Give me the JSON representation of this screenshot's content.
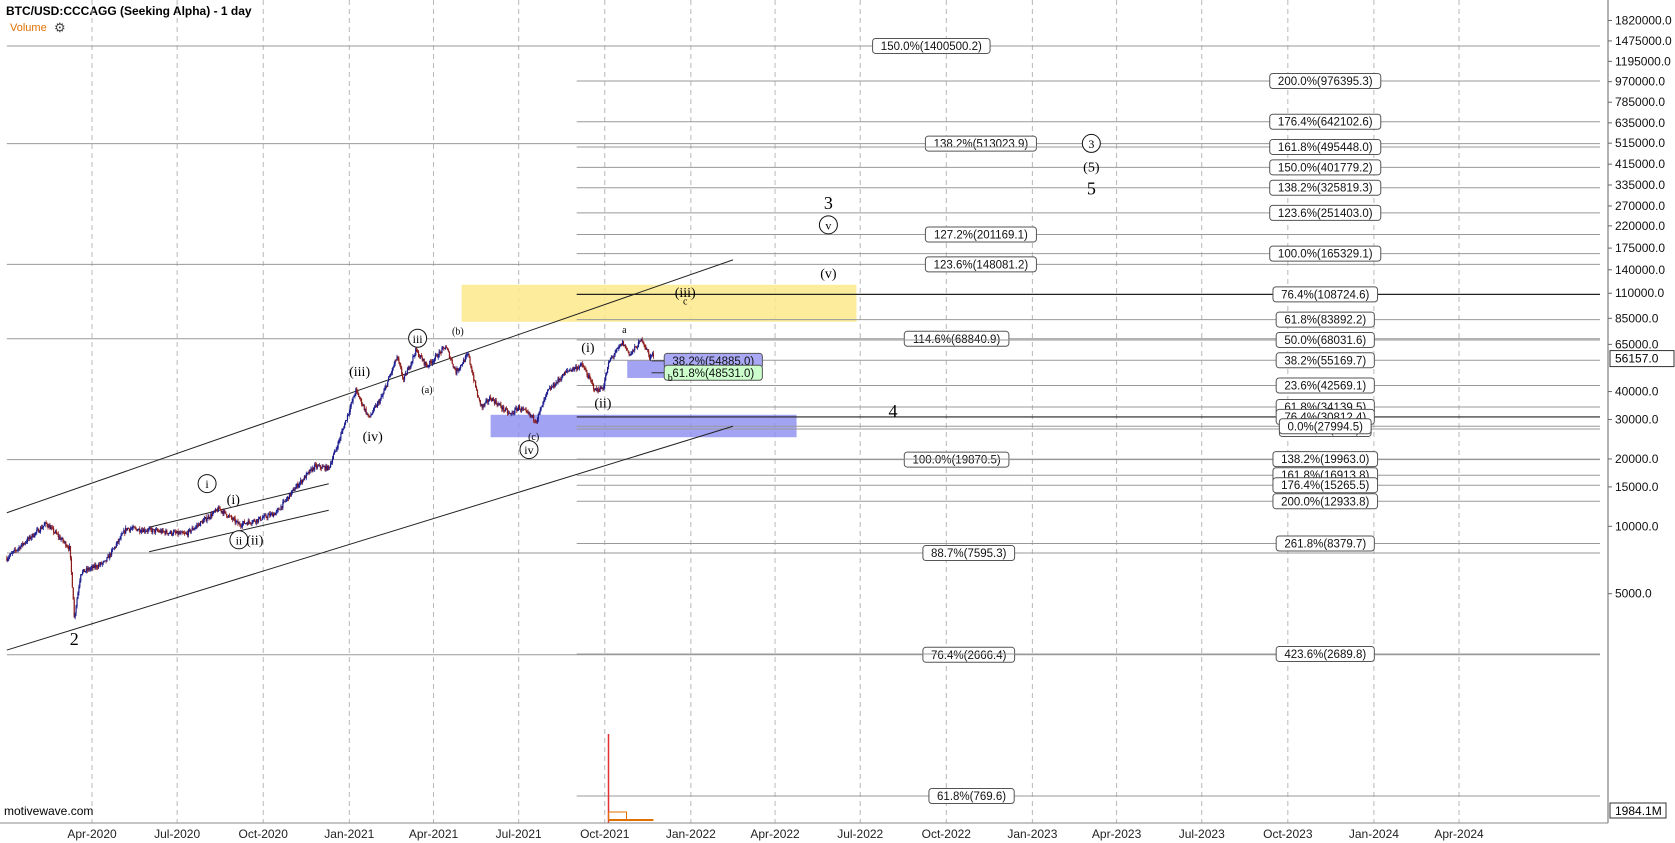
{
  "header": {
    "title": "BTC/USD:CCCAGG (Seeking Alpha) - 1 day",
    "volume_label": "Volume",
    "settings_icon": "gear-icon"
  },
  "watermark": "motivewave.com",
  "colors": {
    "candle_up": "#1a1a8c",
    "candle_down": "#8b1a1a",
    "yellow_zone": "#fbe98a",
    "blue_zone": "#8c8cf0",
    "price_label_bg": "#ffffff",
    "green_label": "#ccffcc",
    "volume": "#e03030"
  },
  "chart_data": {
    "type": "candlestick",
    "title": "BTC/USD:CCCAGG (Seeking Alpha) - 1 day",
    "y_scale": "log",
    "ylim": [
      2000,
      2300000
    ],
    "x_range": [
      "2020-01-01",
      "2024-05-31"
    ],
    "x_tick_labels": [
      "Apr-2020",
      "Jul-2020",
      "Oct-2020",
      "Jan-2021",
      "Apr-2021",
      "Jul-2021",
      "Oct-2021",
      "Jan-2022",
      "Apr-2022",
      "Jul-2022",
      "Oct-2022",
      "Jan-2023",
      "Apr-2023",
      "Jul-2023",
      "Oct-2023",
      "Jan-2024",
      "Apr-2024"
    ],
    "x_ticks": [
      "2020-04-01",
      "2020-07-01",
      "2020-10-01",
      "2021-01-01",
      "2021-04-01",
      "2021-07-01",
      "2021-10-01",
      "2022-01-01",
      "2022-04-01",
      "2022-07-01",
      "2022-10-01",
      "2023-01-01",
      "2023-04-01",
      "2023-07-01",
      "2023-10-01",
      "2024-01-01",
      "2024-04-01"
    ],
    "y_tick_labels": [
      "1820000.0",
      "1475000.0",
      "1195000.0",
      "970000.0",
      "785000.0",
      "635000.0",
      "515000.0",
      "415000.0",
      "335000.0",
      "270000.0",
      "220000.0",
      "175000.0",
      "140000.0",
      "110000.0",
      "85000.0",
      "65000.0",
      "40000.0",
      "30000.0",
      "20000.0",
      "15000.0",
      "10000.0",
      "5000.0"
    ],
    "y_ticks": [
      1820000,
      1475000,
      1195000,
      970000,
      785000,
      635000,
      515000,
      415000,
      335000,
      270000,
      220000,
      175000,
      140000,
      110000,
      85000,
      65000,
      40000,
      30000,
      20000,
      15000,
      10000,
      5000
    ],
    "current_price_label": "56157.0",
    "volume_label": "1984.1M",
    "price_path": [
      [
        "2020-01-01",
        7200
      ],
      [
        "2020-02-12",
        10300
      ],
      [
        "2020-03-08",
        8000
      ],
      [
        "2020-03-12",
        4800
      ],
      [
        "2020-03-13",
        3900
      ],
      [
        "2020-03-20",
        6200
      ],
      [
        "2020-04-15",
        6900
      ],
      [
        "2020-05-08",
        9800
      ],
      [
        "2020-06-01",
        9600
      ],
      [
        "2020-07-10",
        9200
      ],
      [
        "2020-08-15",
        12000
      ],
      [
        "2020-09-05",
        10200
      ],
      [
        "2020-09-25",
        10700
      ],
      [
        "2020-10-15",
        11500
      ],
      [
        "2020-11-05",
        15000
      ],
      [
        "2020-11-25",
        18500
      ],
      [
        "2020-12-10",
        18200
      ],
      [
        "2020-12-20",
        23500
      ],
      [
        "2021-01-08",
        40500
      ],
      [
        "2021-01-22",
        30500
      ],
      [
        "2021-02-05",
        38000
      ],
      [
        "2021-02-21",
        57000
      ],
      [
        "2021-02-28",
        45000
      ],
      [
        "2021-03-13",
        61000
      ],
      [
        "2021-03-25",
        52000
      ],
      [
        "2021-04-14",
        63500
      ],
      [
        "2021-04-25",
        49000
      ],
      [
        "2021-05-08",
        58500
      ],
      [
        "2021-05-19",
        37000
      ],
      [
        "2021-05-23",
        34000
      ],
      [
        "2021-06-01",
        37500
      ],
      [
        "2021-06-22",
        31500
      ],
      [
        "2021-07-01",
        34000
      ],
      [
        "2021-07-20",
        29800
      ],
      [
        "2021-08-01",
        40000
      ],
      [
        "2021-08-22",
        49500
      ],
      [
        "2021-09-07",
        52500
      ],
      [
        "2021-09-21",
        40500
      ],
      [
        "2021-09-29",
        41500
      ],
      [
        "2021-10-06",
        55000
      ],
      [
        "2021-10-20",
        66000
      ],
      [
        "2021-10-28",
        58500
      ],
      [
        "2021-11-10",
        68500
      ],
      [
        "2021-11-18",
        57000
      ],
      [
        "2021-11-21",
        59000
      ],
      [
        "2021-11-22",
        56157
      ]
    ],
    "rays": [
      {
        "from": [
          "2020-01-01",
          11500
        ],
        "to": [
          "2022-02-15",
          155000
        ],
        "name": "upper-channel-line"
      },
      {
        "from": [
          "2020-01-01",
          2800
        ],
        "to": [
          "2022-02-15",
          28000
        ],
        "name": "lower-channel-line"
      },
      {
        "from": [
          "2020-06-01",
          9900
        ],
        "to": [
          "2020-12-10",
          15500
        ],
        "name": "small-upper-line"
      },
      {
        "from": [
          "2020-06-01",
          7700
        ],
        "to": [
          "2020-12-10",
          11800
        ],
        "name": "small-lower-line"
      }
    ],
    "zones": [
      {
        "from": "2021-05-01",
        "to": "2022-06-27",
        "low": 82000,
        "high": 120000,
        "color": "yellow"
      },
      {
        "from": "2021-06-01",
        "to": "2022-04-24",
        "low": 25000,
        "high": 31500,
        "color": "blue"
      },
      {
        "from": "2021-10-25",
        "to": "2021-12-20",
        "low": 46000,
        "high": 55200,
        "color": "blue"
      }
    ],
    "fib_lines": [
      {
        "label": "150.0%(1400500.2)",
        "price": 1400500.2,
        "from": "2020-01-01",
        "label_at": "2022-09-15"
      },
      {
        "label": "138.2%(513023.9)",
        "price": 513023.9,
        "from": "2020-01-01",
        "label_at": "2022-11-07"
      },
      {
        "label": "127.2%(201169.1)",
        "price": 201169.1,
        "from": "2021-09-01",
        "label_at": "2022-11-07"
      },
      {
        "label": "123.6%(148081.2)",
        "price": 148081.2,
        "from": "2020-01-01",
        "label_at": "2022-11-07"
      },
      {
        "label": "114.6%(68840.9)",
        "price": 68840.9,
        "from": "2020-01-01",
        "label_at": "2022-10-12"
      },
      {
        "label": "100.0%(19870.5)",
        "price": 19870.5,
        "from": "2020-01-01",
        "label_at": "2022-10-12"
      },
      {
        "label": "88.7%(7595.3)",
        "price": 7595.3,
        "from": "2020-01-01",
        "label_at": "2022-10-25"
      },
      {
        "label": "76.4%(2666.4)",
        "price": 2666.4,
        "from": "2020-01-01",
        "label_at": "2022-10-25"
      },
      {
        "label": "61.8%(769.6)",
        "price": 769.6,
        "from": "2021-09-01",
        "label_at": "2022-10-28",
        "pinned": true
      },
      {
        "label": "200.0%(976395.3)",
        "price": 976395.3,
        "from": "2021-09-01",
        "label_at": "2023-11-10"
      },
      {
        "label": "176.4%(642102.6)",
        "price": 642102.6,
        "from": "2021-09-01",
        "label_at": "2023-11-10"
      },
      {
        "label": "161.8%(495448.0)",
        "price": 495448.0,
        "from": "2021-09-01",
        "label_at": "2023-11-10"
      },
      {
        "label": "150.0%(401779.2)",
        "price": 401779.2,
        "from": "2021-09-01",
        "label_at": "2023-11-10"
      },
      {
        "label": "138.2%(325819.3)",
        "price": 325819.3,
        "from": "2021-09-01",
        "label_at": "2023-11-10"
      },
      {
        "label": "123.6%(251403.0)",
        "price": 251403.0,
        "from": "2021-09-01",
        "label_at": "2023-11-10"
      },
      {
        "label": "100.0%(165329.1)",
        "price": 165329.1,
        "from": "2021-09-01",
        "label_at": "2023-11-10"
      },
      {
        "label": "76.4%(108724.6)",
        "price": 108724.6,
        "from": "2021-09-01",
        "label_at": "2023-11-10",
        "dark": true
      },
      {
        "label": "61.8%(83892.2)",
        "price": 83892.2,
        "from": "2021-09-01",
        "label_at": "2023-11-10"
      },
      {
        "label": "50.0%(68031.6)",
        "price": 68031.6,
        "from": "2021-09-01",
        "label_at": "2023-11-10"
      },
      {
        "label": "38.2%(55169.7)",
        "price": 55169.7,
        "from": "2021-09-01",
        "label_at": "2023-11-10"
      },
      {
        "label": "23.6%(42569.1)",
        "price": 42569.1,
        "from": "2021-09-01",
        "label_at": "2023-11-10"
      },
      {
        "label": "61.8%(34139.5)",
        "price": 34139.5,
        "from": "2021-09-01",
        "label_at": "2023-11-10"
      },
      {
        "label": "76.4%(30812.4)",
        "price": 30812.4,
        "from": "2021-09-01",
        "label_at": "2023-11-10",
        "dark": true
      },
      {
        "label": "100.0%(26...)",
        "price": 27200,
        "from": "2021-09-01",
        "label_at": "2023-11-10"
      },
      {
        "label": "0.0%(27994.5)",
        "price": 27994.5,
        "from": "2021-09-01",
        "label_at": "2023-11-10"
      },
      {
        "label": "138.2%(19963.0)",
        "price": 19963.0,
        "from": "2021-09-01",
        "label_at": "2023-11-10"
      },
      {
        "label": "161.8%(16913.8)",
        "price": 16913.8,
        "from": "2021-09-01",
        "label_at": "2023-11-10"
      },
      {
        "label": "176.4%(15265.5)",
        "price": 15265.5,
        "from": "2021-09-01",
        "label_at": "2023-11-10"
      },
      {
        "label": "200.0%(12933.8)",
        "price": 12933.8,
        "from": "2021-09-01",
        "label_at": "2023-11-10"
      },
      {
        "label": "261.8%(8379.7)",
        "price": 8379.7,
        "from": "2021-09-01",
        "label_at": "2023-11-10"
      },
      {
        "label": "423.6%(2689.8)",
        "price": 2689.8,
        "from": "2021-09-01",
        "label_at": "2023-11-10"
      }
    ],
    "retracement_labels": [
      {
        "label": "38.2%(54885.0)",
        "price": 54885.0,
        "from": "2021-11-20",
        "label_at": "2022-01-25",
        "bg": "blue"
      },
      {
        "label": "61.8%(48531.0)",
        "price": 48531.0,
        "from": "2021-11-20",
        "label_at": "2022-01-25",
        "bg": "green"
      }
    ],
    "wave_labels": [
      {
        "text": "2",
        "date": "2020-03-13",
        "price": 2950,
        "size": 18
      },
      {
        "text": "i",
        "date": "2020-08-02",
        "price": 14800,
        "circle": true
      },
      {
        "text": "(i)",
        "date": "2020-08-30",
        "price": 12600
      },
      {
        "text": "ii",
        "date": "2020-09-05",
        "price": 8300,
        "circle": true
      },
      {
        "text": "(ii)",
        "date": "2020-09-22",
        "price": 8300
      },
      {
        "text": "(iii)",
        "date": "2021-01-12",
        "price": 47000
      },
      {
        "text": "(iv)",
        "date": "2021-01-26",
        "price": 24000
      },
      {
        "text": "iii",
        "date": "2021-03-15",
        "price": 66000,
        "circle": true
      },
      {
        "text": "(a)",
        "date": "2021-03-25",
        "price": 39500,
        "size": 10
      },
      {
        "text": "(b)",
        "date": "2021-04-27",
        "price": 72000,
        "size": 10
      },
      {
        "text": "(c)",
        "date": "2021-07-17",
        "price": 24300,
        "size": 10
      },
      {
        "text": "iv",
        "date": "2021-07-12",
        "price": 21000,
        "circle": true
      },
      {
        "text": "(i)",
        "date": "2021-09-13",
        "price": 60000
      },
      {
        "text": "(ii)",
        "date": "2021-09-29",
        "price": 34000
      },
      {
        "text": "a",
        "date": "2021-10-22",
        "price": 73000,
        "size": 10
      },
      {
        "text": "b",
        "date": "2021-12-10",
        "price": 44500,
        "size": 10
      },
      {
        "text": "c",
        "date": "2021-12-26",
        "price": 98000,
        "size": 10
      },
      {
        "text": "(iii)",
        "date": "2021-12-26",
        "price": 106000
      },
      {
        "text": "(v)",
        "date": "2022-05-28",
        "price": 128500
      },
      {
        "text": "v",
        "date": "2022-05-28",
        "price": 212000,
        "circle": true
      },
      {
        "text": "3",
        "date": "2022-05-28",
        "price": 262000,
        "size": 18
      },
      {
        "text": "4",
        "date": "2022-08-05",
        "price": 30800,
        "size": 18
      },
      {
        "text": "3",
        "date": "2023-03-05",
        "price": 490000,
        "circle": true
      },
      {
        "text": "(5)",
        "date": "2023-03-05",
        "price": 385000
      },
      {
        "text": "5",
        "date": "2023-03-05",
        "price": 304000,
        "size": 18
      }
    ]
  }
}
